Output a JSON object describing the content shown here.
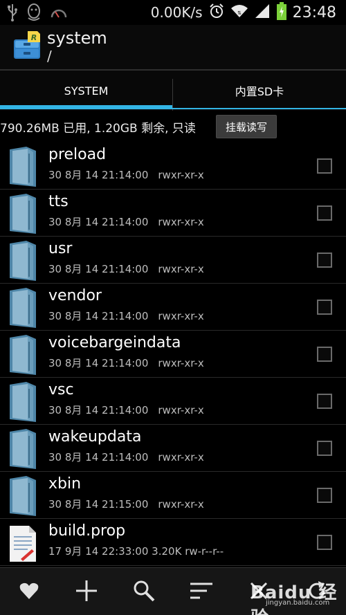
{
  "status_bar": {
    "speed": "0.00K/s",
    "time": "23:48"
  },
  "app": {
    "title": "system",
    "path": "/"
  },
  "tabs": [
    {
      "label": "SYSTEM",
      "active": true
    },
    {
      "label": "内置SD卡",
      "active": false
    }
  ],
  "storage": {
    "info": "790.26MB 已用, 1.20GB 剩余, 只读",
    "mount_button": "挂载读写"
  },
  "files": [
    {
      "name": "preload",
      "date": "30 8月 14 21:14:00",
      "perm": "rwxr-xr-x",
      "type": "folder"
    },
    {
      "name": "tts",
      "date": "30 8月 14 21:14:00",
      "perm": "rwxr-xr-x",
      "type": "folder"
    },
    {
      "name": "usr",
      "date": "30 8月 14 21:14:00",
      "perm": "rwxr-xr-x",
      "type": "folder"
    },
    {
      "name": "vendor",
      "date": "30 8月 14 21:14:00",
      "perm": "rwxr-xr-x",
      "type": "folder"
    },
    {
      "name": "voicebargeindata",
      "date": "30 8月 14 21:14:00",
      "perm": "rwxr-xr-x",
      "type": "folder"
    },
    {
      "name": "vsc",
      "date": "30 8月 14 21:14:00",
      "perm": "rwxr-xr-x",
      "type": "folder"
    },
    {
      "name": "wakeupdata",
      "date": "30 8月 14 21:14:00",
      "perm": "rwxr-xr-x",
      "type": "folder"
    },
    {
      "name": "xbin",
      "date": "30 8月 14 21:15:00",
      "perm": "rwxr-xr-x",
      "type": "folder"
    },
    {
      "name": "build.prop",
      "date": "17 9月 14 22:33:00",
      "size": "3.20K",
      "perm": "rw-r--r--",
      "type": "file"
    }
  ],
  "bottom_bar": {
    "icons": [
      "heart-icon",
      "plus-icon",
      "search-icon",
      "sort-icon",
      "close-icon",
      "refresh-icon"
    ]
  },
  "watermark": {
    "text": "Baidu 经验",
    "url": "jingyan.baidu.com"
  },
  "colors": {
    "accent": "#33b5e5",
    "battery": "#7cd13a"
  }
}
